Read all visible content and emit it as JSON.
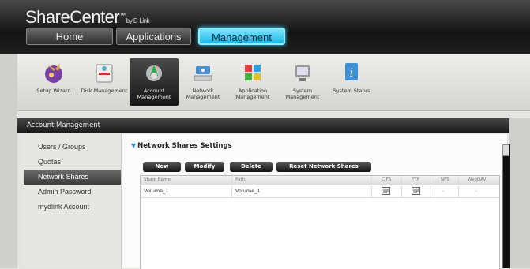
{
  "app": {
    "name": "ShareCenter",
    "mark": "™",
    "byline": "by D-Link"
  },
  "nav": {
    "tabs": [
      {
        "label": "Home"
      },
      {
        "label": "Applications"
      },
      {
        "label": "Management"
      }
    ]
  },
  "toolbar": {
    "items": [
      {
        "label": "Setup Wizard",
        "icon": "wizard-icon"
      },
      {
        "label": "Disk Management",
        "icon": "disk-icon"
      },
      {
        "label": "Account Management",
        "icon": "account-icon"
      },
      {
        "label": "Network Management",
        "icon": "network-icon"
      },
      {
        "label": "Application Management",
        "icon": "application-icon"
      },
      {
        "label": "System Management",
        "icon": "system-icon"
      },
      {
        "label": "System Status",
        "icon": "info-icon"
      }
    ]
  },
  "section": {
    "title": "Account Management"
  },
  "sidebar": {
    "items": [
      {
        "label": "Users / Groups"
      },
      {
        "label": "Quotas"
      },
      {
        "label": "Network Shares"
      },
      {
        "label": "Admin Password"
      },
      {
        "label": "mydlink Account"
      }
    ]
  },
  "panel": {
    "title": "Network Shares Settings",
    "buttons": {
      "new": "New",
      "modify": "Modify",
      "delete": "Delete",
      "reset": "Reset Network Shares"
    }
  },
  "table": {
    "headers": [
      "Share Name",
      "Path",
      "CIFS",
      "FTP",
      "NFS",
      "WebDAV"
    ],
    "rows": [
      {
        "share_name": "Volume_1",
        "path": "Volume_1",
        "cifs": "edit-icon",
        "ftp": "edit-icon",
        "nfs": "-",
        "webdav": "-"
      }
    ]
  }
}
